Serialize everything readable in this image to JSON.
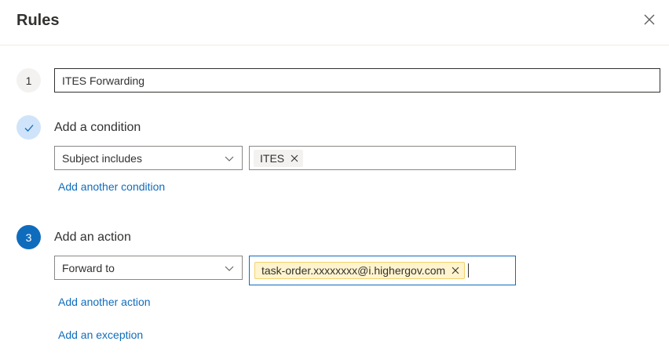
{
  "header": {
    "title": "Rules",
    "close_icon": "close-icon"
  },
  "step1": {
    "number": "1",
    "rule_name_value": "ITES Forwarding"
  },
  "step2": {
    "status_icon": "checkmark-icon",
    "title": "Add a condition",
    "condition_select": "Subject includes",
    "condition_tag": "ITES",
    "add_link": "Add another condition"
  },
  "step3": {
    "number": "3",
    "title": "Add an action",
    "action_select": "Forward to",
    "recipient_tag": "task-order.xxxxxxxx@i.highergov.com",
    "add_link": "Add another action"
  },
  "exception_link": "Add an exception",
  "colors": {
    "accent": "#0f6cbd",
    "check_circle": "#cfe4fa",
    "tag_yellow": "#fff4ce",
    "tag_grey": "#f3f2f1"
  }
}
